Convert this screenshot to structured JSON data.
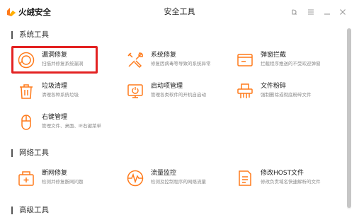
{
  "app": {
    "brand": "火绒安全",
    "title": "安全工具",
    "accent": "#ff7a1a",
    "controls": [
      {
        "name": "restore-icon",
        "glyph": "ʖ"
      },
      {
        "name": "menu-icon",
        "glyph": "≡"
      },
      {
        "name": "minimize-icon",
        "glyph": "_"
      },
      {
        "name": "close-icon",
        "glyph": "✕"
      }
    ]
  },
  "sections": {
    "system": {
      "title": "系统工具",
      "tools": [
        {
          "name": "漏洞修复",
          "desc": "扫描并修复系统漏洞",
          "icon": "vulnerability-fix-icon",
          "highlighted": true
        },
        {
          "name": "系统修复",
          "desc": "修复因病毒等导致的系统异常",
          "icon": "system-repair-icon"
        },
        {
          "name": "弹窗拦截",
          "desc": "拦截程序推送的不受欢迎弹窗",
          "icon": "popup-block-icon"
        },
        {
          "name": "垃圾清理",
          "desc": "清理各种系统垃圾",
          "icon": "trash-clean-icon"
        },
        {
          "name": "启动项管理",
          "desc": "管理各类软件的开机自启动",
          "icon": "startup-manager-icon"
        },
        {
          "name": "文件粉碎",
          "desc": "强制删除或彻底粉碎文件",
          "icon": "file-shredder-icon"
        },
        {
          "name": "右键管理",
          "desc": "管理文件、桌面、IE右键菜单",
          "icon": "right-click-manager-icon"
        }
      ]
    },
    "network": {
      "title": "网络工具",
      "tools": [
        {
          "name": "断网修复",
          "desc": "检测并修复断网问题",
          "icon": "network-repair-icon"
        },
        {
          "name": "流量监控",
          "desc": "检测及控制程序的网络流量",
          "icon": "traffic-monitor-icon"
        },
        {
          "name": "修改HOST文件",
          "desc": "修改负责域名快速解析的文件",
          "icon": "host-file-icon"
        }
      ]
    },
    "advanced": {
      "title": "高级工具"
    }
  },
  "highlight_color": "#e32222"
}
